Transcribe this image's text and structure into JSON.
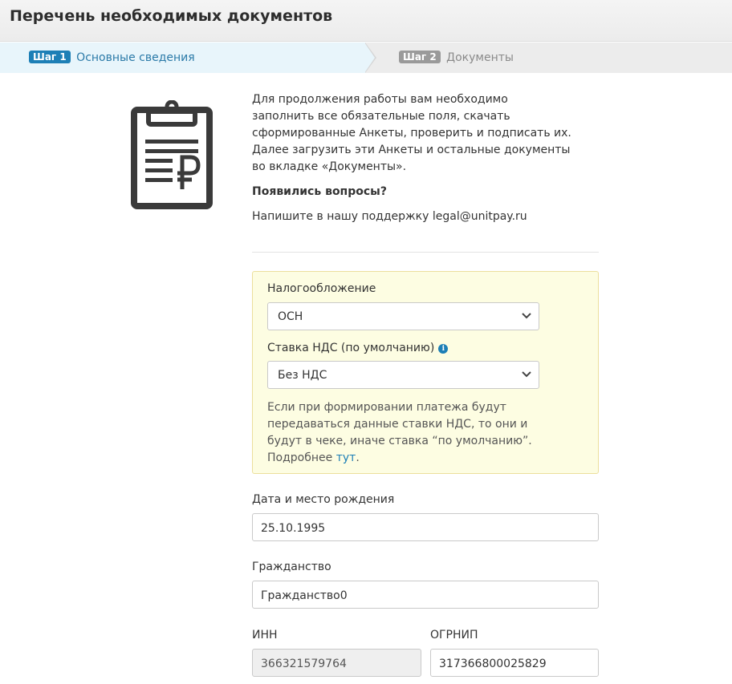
{
  "header": {
    "title": "Перечень необходимых документов"
  },
  "steps": [
    {
      "badge": "Шаг 1",
      "label": "Основные сведения",
      "active": true
    },
    {
      "badge": "Шаг 2",
      "label": "Документы",
      "active": false
    }
  ],
  "icon": {
    "clipboard": "clipboard-ruble-icon"
  },
  "intro": {
    "text": "Для продолжения работы вам необходимо заполнить все обязательные поля, скачать сформированные Анкеты, проверить и подписать их. Далее загрузить эти Анкеты и остальные документы во вкладке «Документы».",
    "questions_title": "Появились вопросы?",
    "support_text": "Напишите в нашу поддержку legal@unitpay.ru"
  },
  "tax": {
    "taxation_label": "Налогообложение",
    "taxation_value": "ОСН",
    "vat_label": "Ставка НДС (по умолчанию)",
    "vat_value": "Без НДС",
    "note_text": "Если при формировании платежа будут передаваться данные ставки НДС, то они и будут в чеке, иначе ставка “по умолчанию”. Подробнее ",
    "note_link": "тут",
    "note_end": "."
  },
  "form": {
    "birth_label": "Дата и место рождения",
    "birth_value": "25.10.1995",
    "citizenship_label": "Гражданство",
    "citizenship_value": "Гражданство0",
    "inn_label": "ИНН",
    "inn_value": "366321579764",
    "ogrnip_label": "ОГРНИП",
    "ogrnip_value": "317366800025829"
  },
  "colors": {
    "accent": "#1d7fb6",
    "note_bg": "#fdfde2",
    "note_border": "#ecdf9c"
  }
}
